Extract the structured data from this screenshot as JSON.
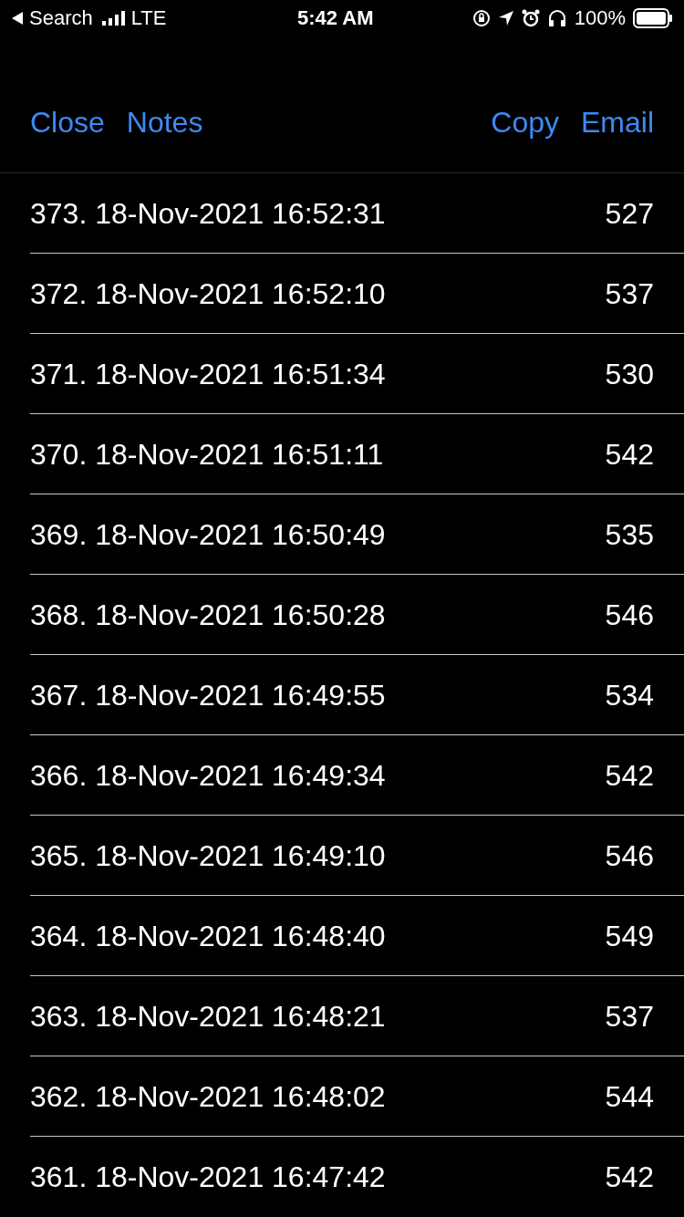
{
  "status_bar": {
    "back_label": "Search",
    "network": "LTE",
    "time": "5:42 AM",
    "battery": "100%"
  },
  "nav": {
    "left_buttons": [
      "Close",
      "Notes"
    ],
    "right_buttons": [
      "Copy",
      "Email"
    ]
  },
  "rows": [
    {
      "label": "373. 18-Nov-2021 16:52:31",
      "value": "527"
    },
    {
      "label": "372. 18-Nov-2021 16:52:10",
      "value": "537"
    },
    {
      "label": "371. 18-Nov-2021 16:51:34",
      "value": "530"
    },
    {
      "label": "370. 18-Nov-2021 16:51:11",
      "value": "542"
    },
    {
      "label": "369. 18-Nov-2021 16:50:49",
      "value": "535"
    },
    {
      "label": "368. 18-Nov-2021 16:50:28",
      "value": "546"
    },
    {
      "label": "367. 18-Nov-2021 16:49:55",
      "value": "534"
    },
    {
      "label": "366. 18-Nov-2021 16:49:34",
      "value": "542"
    },
    {
      "label": "365. 18-Nov-2021 16:49:10",
      "value": "546"
    },
    {
      "label": "364. 18-Nov-2021 16:48:40",
      "value": "549"
    },
    {
      "label": "363. 18-Nov-2021 16:48:21",
      "value": "537"
    },
    {
      "label": "362. 18-Nov-2021 16:48:02",
      "value": "544"
    },
    {
      "label": "361. 18-Nov-2021 16:47:42",
      "value": "542"
    }
  ]
}
